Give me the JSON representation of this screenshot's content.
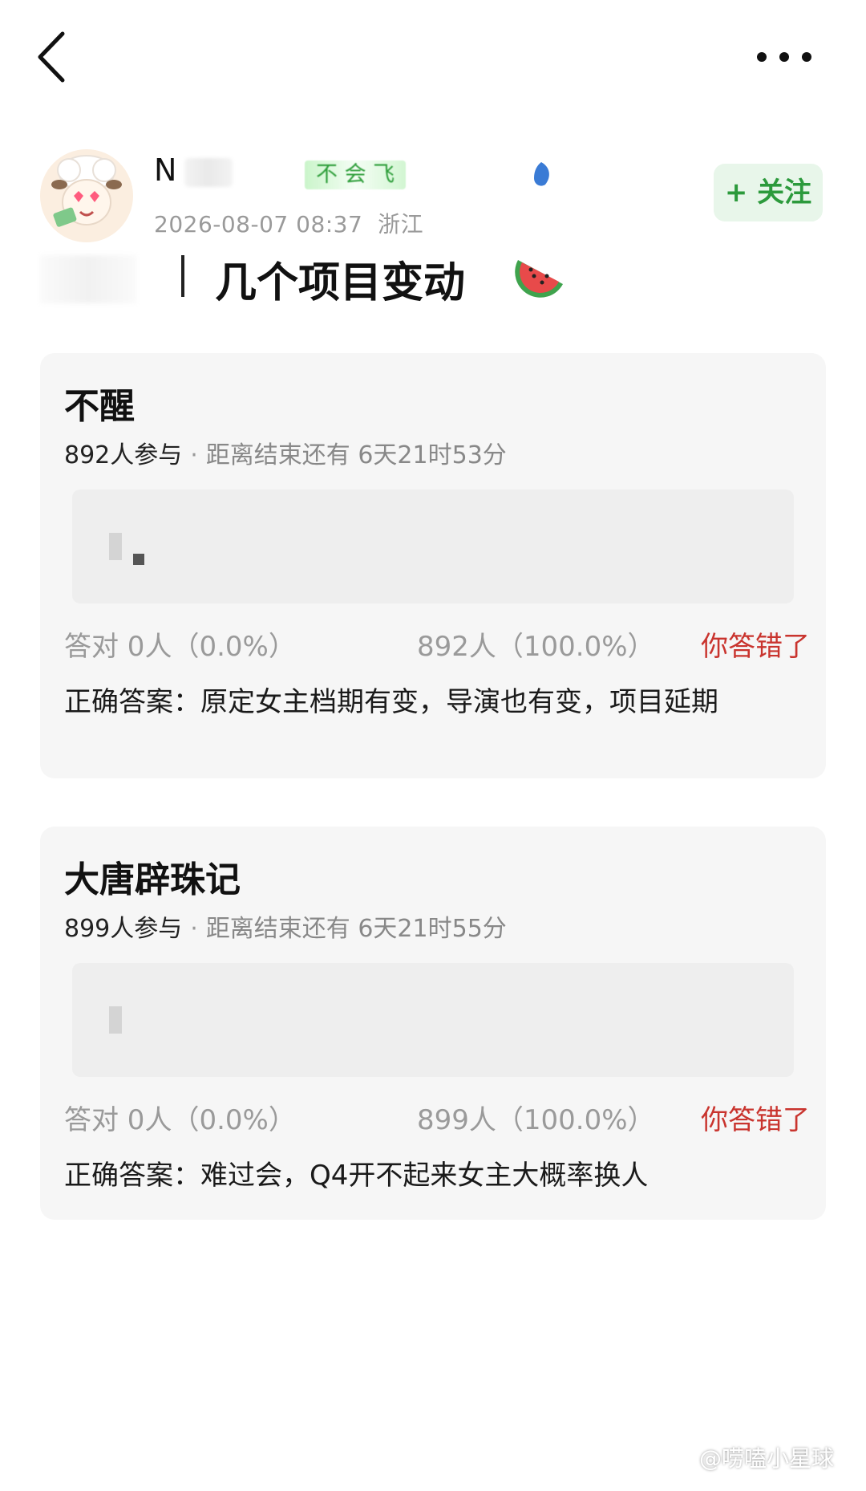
{
  "nav": {
    "back_icon": "chevron-left-icon",
    "more_icon": "more-horizontal-icon"
  },
  "author": {
    "name": "N",
    "badge": "不 会 飞",
    "post_time": "2026-08-07 08:37",
    "location": "浙江",
    "follow_label": "+ 关注"
  },
  "post": {
    "title": "几个项目变动",
    "title_icon": "watermelon-icon"
  },
  "cards": [
    {
      "title": "不醒",
      "participants": "892人参与",
      "separator": "·",
      "countdown": "距离结束还有 6天21时53分",
      "correct_stat": "答对  0人（0.0%）",
      "other_stat": "892人（100.0%）",
      "result": "你答错了",
      "answer": "正确答案：原定女主档期有变，导演也有变，项目延期"
    },
    {
      "title": "大唐辟珠记",
      "participants": "899人参与",
      "separator": "·",
      "countdown": "距离结束还有 6天21时55分",
      "correct_stat": "答对  0人（0.0%）",
      "other_stat": "899人（100.0%）",
      "result": "你答错了",
      "answer": "正确答案：难过会，Q4开不起来女主大概率换人"
    }
  ],
  "watermark": {
    "text": "@唠嗑小星球",
    "icon": "weibo-icon"
  },
  "colors": {
    "accent_green": "#2c9a3c",
    "follow_bg": "#e8f6ea",
    "wrong_red": "#c9342e",
    "card_bg": "#f6f6f6"
  }
}
